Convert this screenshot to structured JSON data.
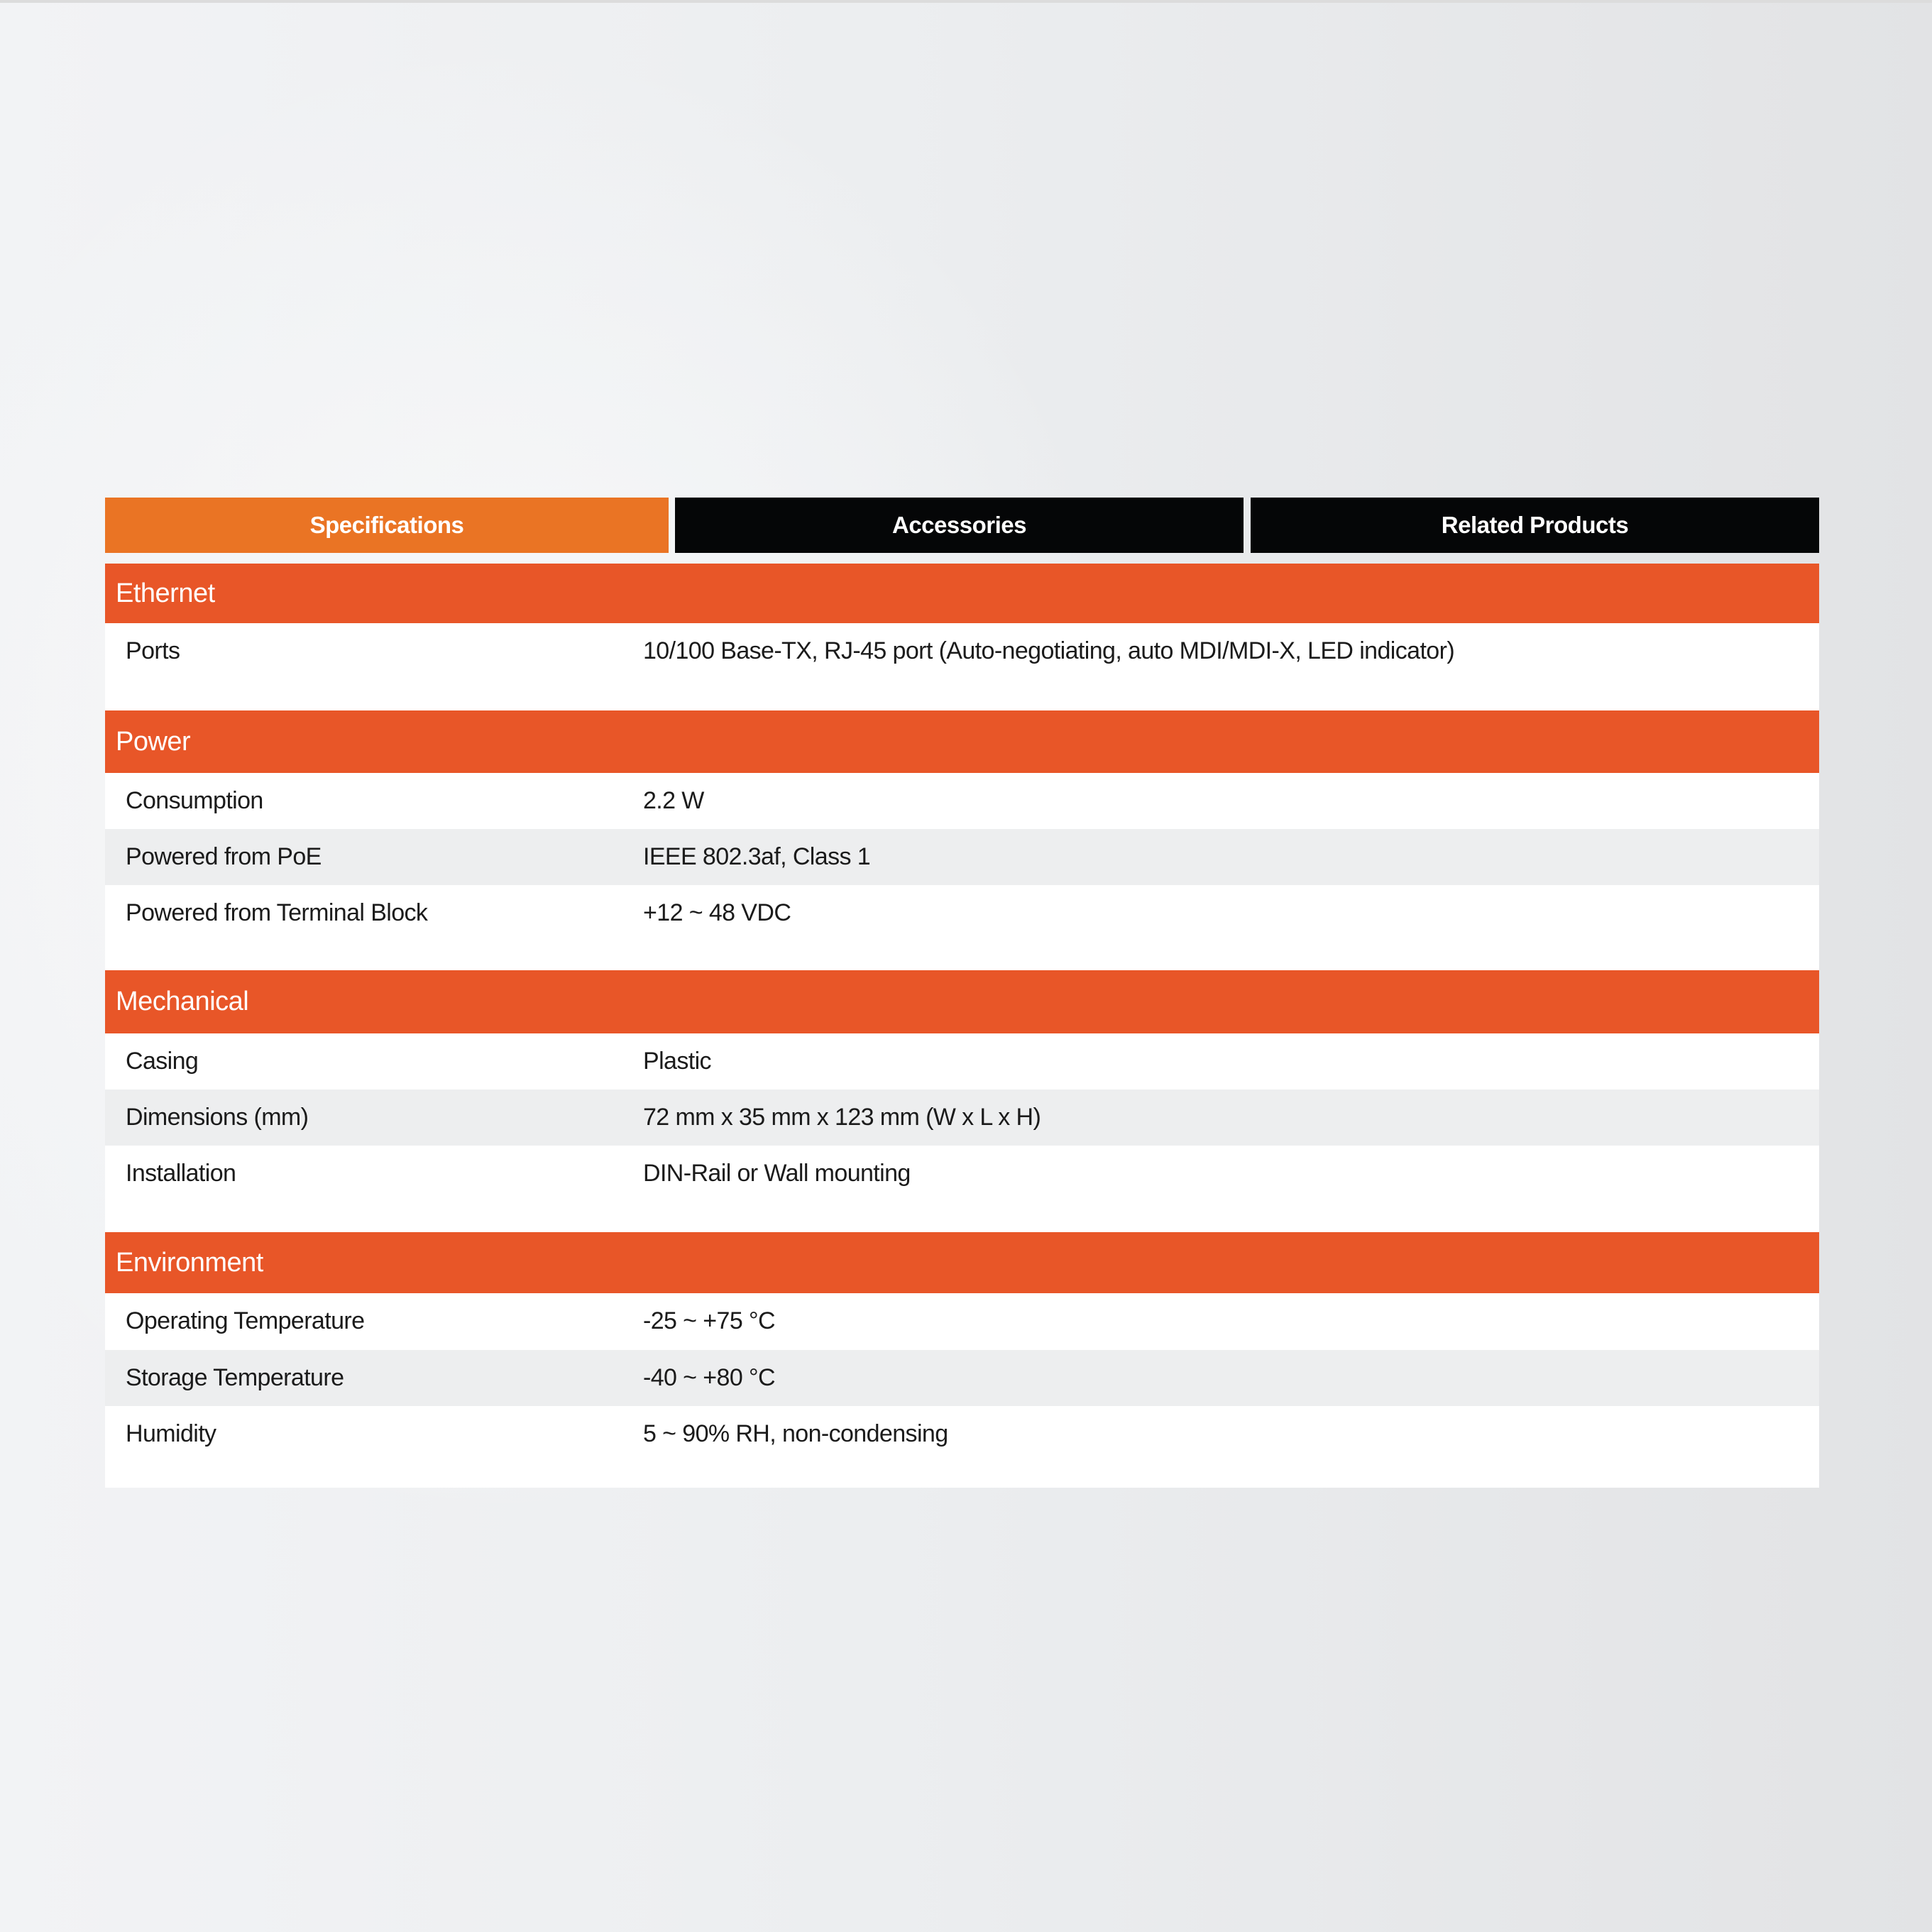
{
  "tabs": [
    {
      "label": "Specifications",
      "active": true
    },
    {
      "label": "Accessories",
      "active": false
    },
    {
      "label": "Related Products",
      "active": false
    }
  ],
  "colors": {
    "active_tab": "#ea7424",
    "inactive_tab": "#050607",
    "section_header": "#e85628",
    "alt_row": "#edeeef"
  },
  "sections": [
    {
      "title": "Ethernet",
      "rows": [
        {
          "label": "Ports",
          "value": "10/100 Base-TX, RJ-45 port (Auto-negotiating, auto MDI/MDI-X, LED indicator)"
        }
      ]
    },
    {
      "title": "Power",
      "rows": [
        {
          "label": "Consumption",
          "value": "2.2 W"
        },
        {
          "label": "Powered from PoE",
          "value": "IEEE 802.3af, Class 1"
        },
        {
          "label": "Powered from Terminal Block",
          "value": "+12 ~ 48 VDC"
        }
      ]
    },
    {
      "title": "Mechanical",
      "rows": [
        {
          "label": "Casing",
          "value": "Plastic"
        },
        {
          "label": "Dimensions (mm)",
          "value": "72 mm x 35 mm x 123 mm (W x L x H)"
        },
        {
          "label": "Installation",
          "value": "DIN-Rail or Wall mounting"
        }
      ]
    },
    {
      "title": "Environment",
      "rows": [
        {
          "label": "Operating Temperature",
          "value": "-25 ~ +75 °C"
        },
        {
          "label": "Storage Temperature",
          "value": "-40 ~ +80 °C"
        },
        {
          "label": "Humidity",
          "value": "5 ~ 90% RH, non-condensing"
        }
      ]
    }
  ]
}
